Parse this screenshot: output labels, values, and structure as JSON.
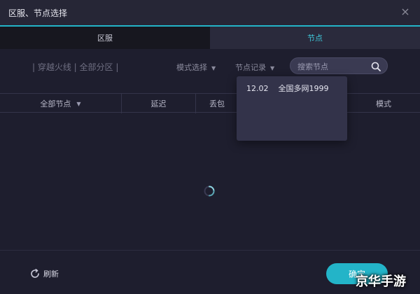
{
  "window": {
    "title": "区服、节点选择",
    "close_glyph": "×"
  },
  "tabs": [
    {
      "label": "区服",
      "active": false
    },
    {
      "label": "节点",
      "active": true
    }
  ],
  "filters": {
    "breadcrumb": "| 穿越火线 | 全部分区 |",
    "mode_select": "模式选择",
    "node_history": "节点记录",
    "search_placeholder": "搜索节点"
  },
  "table": {
    "headers": [
      "全部节点",
      "延迟",
      "丢包",
      "模式"
    ]
  },
  "dropdown": {
    "items": [
      {
        "date": "12.02",
        "name": "全国多网1999"
      }
    ]
  },
  "footer": {
    "refresh_label": "刷新",
    "confirm_label": "确定"
  },
  "watermark": "京华手游",
  "colors": {
    "accent": "#23b4c8",
    "background": "#1e1e2e",
    "active_tab_text": "#3fc7d8"
  },
  "icons": [
    "close-icon",
    "search-icon",
    "chevron-down-icon",
    "loading-spinner-icon",
    "refresh-icon"
  ]
}
